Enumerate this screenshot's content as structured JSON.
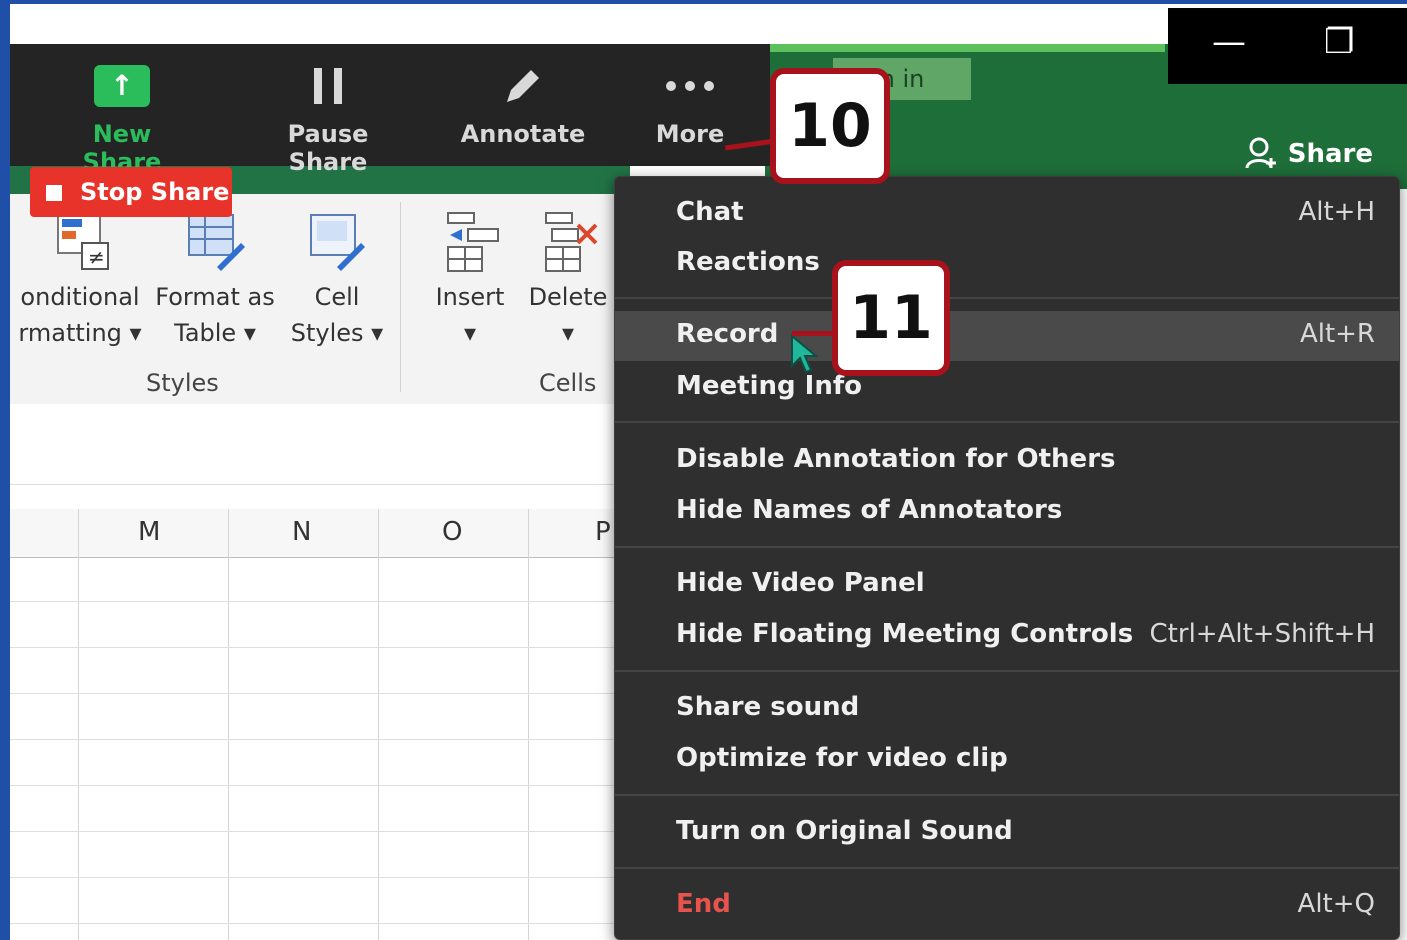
{
  "zoom_toolbar": {
    "new_share": "New Share",
    "pause_share": "Pause Share",
    "annotate": "Annotate",
    "more": "More",
    "stop_share": "Stop Share"
  },
  "zoom_window": {
    "pin_label": "n in",
    "share_label": "Share"
  },
  "excel_ribbon": {
    "conditional_line1": "onditional",
    "conditional_line2": "rmatting",
    "format_table_line1": "Format as",
    "format_table_line2": "Table",
    "cell_styles_line1": "Cell",
    "cell_styles_line2": "Styles",
    "insert": "Insert",
    "delete": "Delete",
    "styles_group": "Styles",
    "cells_group": "Cells"
  },
  "sheet": {
    "columns": [
      "M",
      "N",
      "O",
      "P"
    ]
  },
  "more_menu": {
    "chat": {
      "label": "Chat",
      "shortcut": "Alt+H"
    },
    "reactions": {
      "label": "Reactions"
    },
    "record": {
      "label": "Record",
      "shortcut": "Alt+R"
    },
    "meeting_info": {
      "label": "Meeting Info"
    },
    "disable_annotation": {
      "label": "Disable Annotation for Others"
    },
    "hide_annotator_names": {
      "label": "Hide Names of Annotators"
    },
    "hide_video_panel": {
      "label": "Hide Video Panel"
    },
    "hide_floating_controls": {
      "label": "Hide Floating Meeting Controls",
      "shortcut": "Ctrl+Alt+Shift+H"
    },
    "share_sound": {
      "label": "Share sound"
    },
    "optimize_video": {
      "label": "Optimize for video clip"
    },
    "original_sound": {
      "label": "Turn on Original Sound"
    },
    "end": {
      "label": "End",
      "shortcut": "Alt+Q"
    }
  },
  "callouts": {
    "step_more": "10",
    "step_record": "11"
  },
  "colors": {
    "toolbar_bg": "#242424",
    "menu_bg": "#2f2f2f",
    "stop_share_red": "#e8332b",
    "new_share_green": "#2bbd5c",
    "excel_green": "#217346",
    "callout_border": "#a8121c",
    "end_text": "#e8534d"
  }
}
